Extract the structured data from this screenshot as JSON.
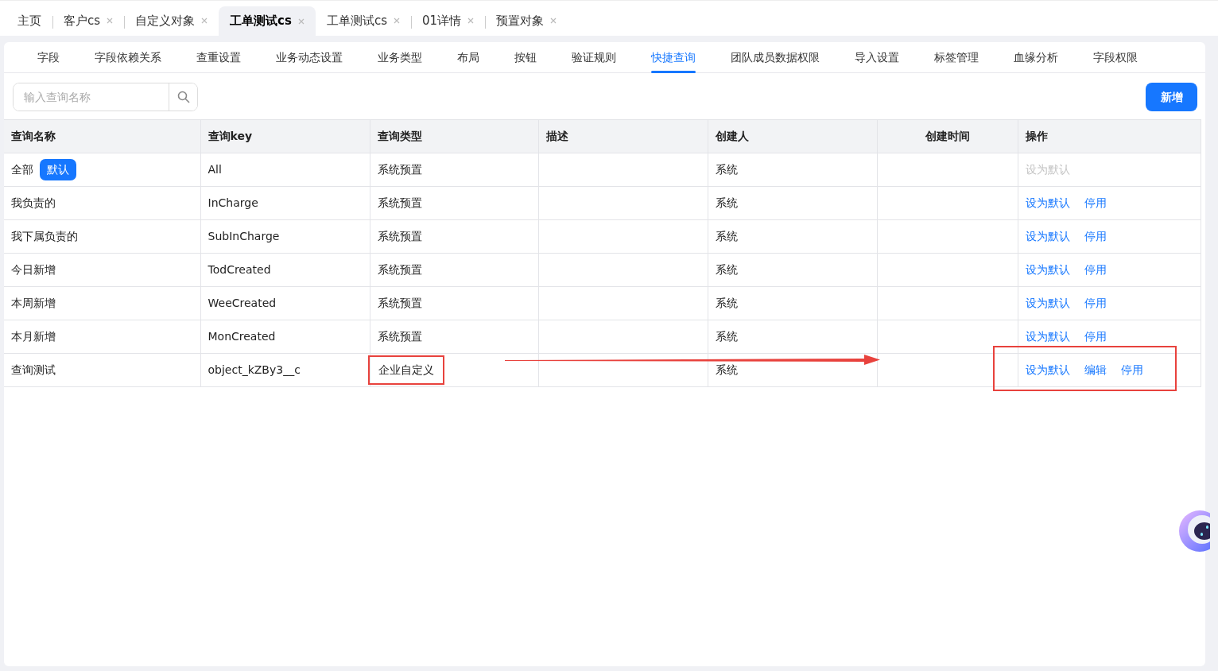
{
  "top_tabs": [
    {
      "label": "主页",
      "selected": false,
      "closable": false
    },
    {
      "label": "客户cs",
      "selected": false,
      "closable": true
    },
    {
      "label": "自定义对象",
      "selected": false,
      "closable": true
    },
    {
      "label": "工单测试cs",
      "selected": true,
      "closable": true
    },
    {
      "label": "工单测试cs",
      "selected": false,
      "closable": true
    },
    {
      "label": "01详情",
      "selected": false,
      "closable": true
    },
    {
      "label": "预置对象",
      "selected": false,
      "closable": true
    }
  ],
  "sub_tabs": [
    {
      "label": "字段",
      "selected": false
    },
    {
      "label": "字段依赖关系",
      "selected": false
    },
    {
      "label": "查重设置",
      "selected": false
    },
    {
      "label": "业务动态设置",
      "selected": false
    },
    {
      "label": "业务类型",
      "selected": false
    },
    {
      "label": "布局",
      "selected": false
    },
    {
      "label": "按钮",
      "selected": false
    },
    {
      "label": "验证规则",
      "selected": false
    },
    {
      "label": "快捷查询",
      "selected": true
    },
    {
      "label": "团队成员数据权限",
      "selected": false
    },
    {
      "label": "导入设置",
      "selected": false
    },
    {
      "label": "标签管理",
      "selected": false
    },
    {
      "label": "血缘分析",
      "selected": false
    },
    {
      "label": "字段权限",
      "selected": false
    }
  ],
  "search": {
    "placeholder": "输入查询名称"
  },
  "add_button": "新增",
  "table": {
    "columns": [
      "查询名称",
      "查询key",
      "查询类型",
      "描述",
      "创建人",
      "创建时间",
      "操作"
    ],
    "rows": [
      {
        "name": "全部",
        "badge": "默认",
        "key": "All",
        "type": "系统预置",
        "creator": "系统",
        "highlighted": false,
        "actions": [
          {
            "label": "设为默认",
            "disabled": true
          }
        ]
      },
      {
        "name": "我负责的",
        "key": "InCharge",
        "type": "系统预置",
        "creator": "系统",
        "highlighted": false,
        "actions": [
          {
            "label": "设为默认",
            "disabled": false
          },
          {
            "label": "停用",
            "disabled": false
          }
        ]
      },
      {
        "name": "我下属负责的",
        "key": "SubInCharge",
        "type": "系统预置",
        "creator": "系统",
        "highlighted": false,
        "actions": [
          {
            "label": "设为默认",
            "disabled": false
          },
          {
            "label": "停用",
            "disabled": false
          }
        ]
      },
      {
        "name": "今日新增",
        "key": "TodCreated",
        "type": "系统预置",
        "creator": "系统",
        "highlighted": false,
        "actions": [
          {
            "label": "设为默认",
            "disabled": false
          },
          {
            "label": "停用",
            "disabled": false
          }
        ]
      },
      {
        "name": "本周新增",
        "key": "WeeCreated",
        "type": "系统预置",
        "creator": "系统",
        "highlighted": false,
        "actions": [
          {
            "label": "设为默认",
            "disabled": false
          },
          {
            "label": "停用",
            "disabled": false
          }
        ]
      },
      {
        "name": "本月新增",
        "key": "MonCreated",
        "type": "系统预置",
        "creator": "系统",
        "highlighted": false,
        "actions": [
          {
            "label": "设为默认",
            "disabled": false
          },
          {
            "label": "停用",
            "disabled": false
          }
        ]
      },
      {
        "name": "查询测试",
        "key": "object_kZBy3__c",
        "type": "企业自定义",
        "creator": "系统",
        "highlighted": true,
        "actions": [
          {
            "label": "设为默认",
            "disabled": false
          },
          {
            "label": "编辑",
            "disabled": false
          },
          {
            "label": "停用",
            "disabled": false
          }
        ]
      }
    ]
  }
}
